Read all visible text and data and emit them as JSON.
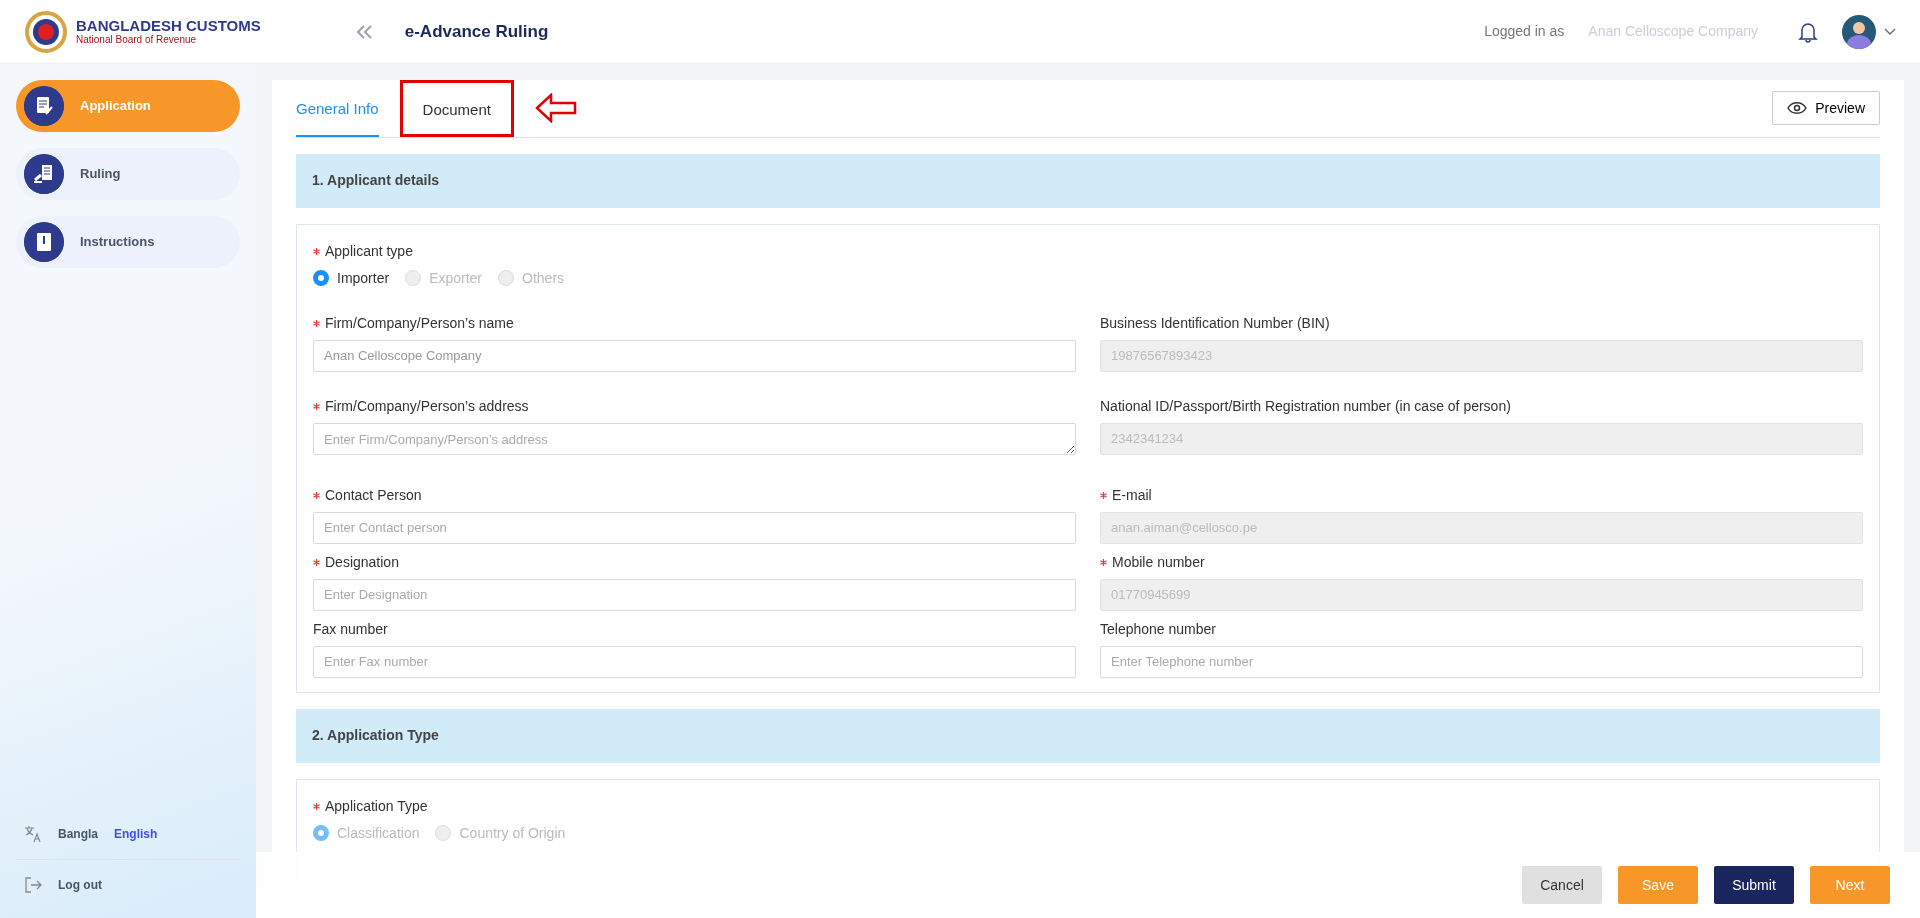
{
  "header": {
    "brand_title": "BANGLADESH CUSTOMS",
    "brand_subtitle": "National Board of Revenue",
    "page_title": "e-Advance Ruling",
    "logged_in_label": "Logged in as",
    "user_name": "Anan Celloscope Company"
  },
  "sidebar": {
    "items": [
      {
        "label": "Application",
        "selected": true
      },
      {
        "label": "Ruling",
        "selected": false
      },
      {
        "label": "Instructions",
        "selected": false
      }
    ],
    "languages": [
      {
        "label": "Bangla",
        "selected": false
      },
      {
        "label": "English",
        "selected": true
      }
    ],
    "logout": "Log out"
  },
  "tabs": [
    {
      "label": "General Info",
      "selected": true,
      "highlighted": false
    },
    {
      "label": "Document",
      "selected": false,
      "highlighted": true
    }
  ],
  "preview_button": "Preview",
  "sections": [
    {
      "title": "1. Applicant details",
      "radio_group": {
        "label": "Applicant type",
        "required": true,
        "options": [
          {
            "label": "Importer",
            "selected": true,
            "disabled": false
          },
          {
            "label": "Exporter",
            "selected": false,
            "disabled": true
          },
          {
            "label": "Others",
            "selected": false,
            "disabled": true
          }
        ]
      },
      "fields": [
        {
          "label": "Firm/Company/Person’s name",
          "required": true,
          "kind": "input",
          "value": "Anan Celloscope Company",
          "disabled": false
        },
        {
          "label": "Business Identification Number (BIN)",
          "required": false,
          "kind": "input",
          "value": "19876567893423",
          "disabled": true
        },
        {
          "label": "Firm/Company/Person’s address",
          "required": true,
          "kind": "textarea",
          "placeholder": "Enter Firm/Company/Person’s address",
          "disabled": false
        },
        {
          "label": "National ID/Passport/Birth Registration number (in case of person)",
          "required": false,
          "kind": "input",
          "value": "2342341234",
          "disabled": true
        },
        {
          "label": "Contact Person",
          "required": true,
          "kind": "input",
          "placeholder": "Enter Contact person",
          "disabled": false
        },
        {
          "label": "E-mail",
          "required": true,
          "kind": "input",
          "value": "anan.aiman@cellosco.pe",
          "disabled": true
        },
        {
          "label": "Designation",
          "required": true,
          "kind": "input",
          "placeholder": "Enter Designation",
          "disabled": false
        },
        {
          "label": "Mobile number",
          "required": true,
          "kind": "input",
          "value": "01770945699",
          "disabled": true
        },
        {
          "label": "Fax number",
          "required": false,
          "kind": "input",
          "placeholder": "Enter Fax number",
          "disabled": false
        },
        {
          "label": "Telephone number",
          "required": false,
          "kind": "input",
          "placeholder": "Enter Telephone number",
          "disabled": false
        }
      ]
    },
    {
      "title": "2. Application Type",
      "radio_group": {
        "label": "Application Type",
        "required": true,
        "options": [
          {
            "label": "Classification",
            "selected": true,
            "disabled": true
          },
          {
            "label": "Country of Origin",
            "selected": false,
            "disabled": true
          }
        ]
      }
    }
  ],
  "footer_buttons": [
    {
      "label": "Cancel",
      "kind": "secondary"
    },
    {
      "label": "Save",
      "kind": "warning"
    },
    {
      "label": "Submit",
      "kind": "primary"
    },
    {
      "label": "Next",
      "kind": "warning"
    }
  ]
}
